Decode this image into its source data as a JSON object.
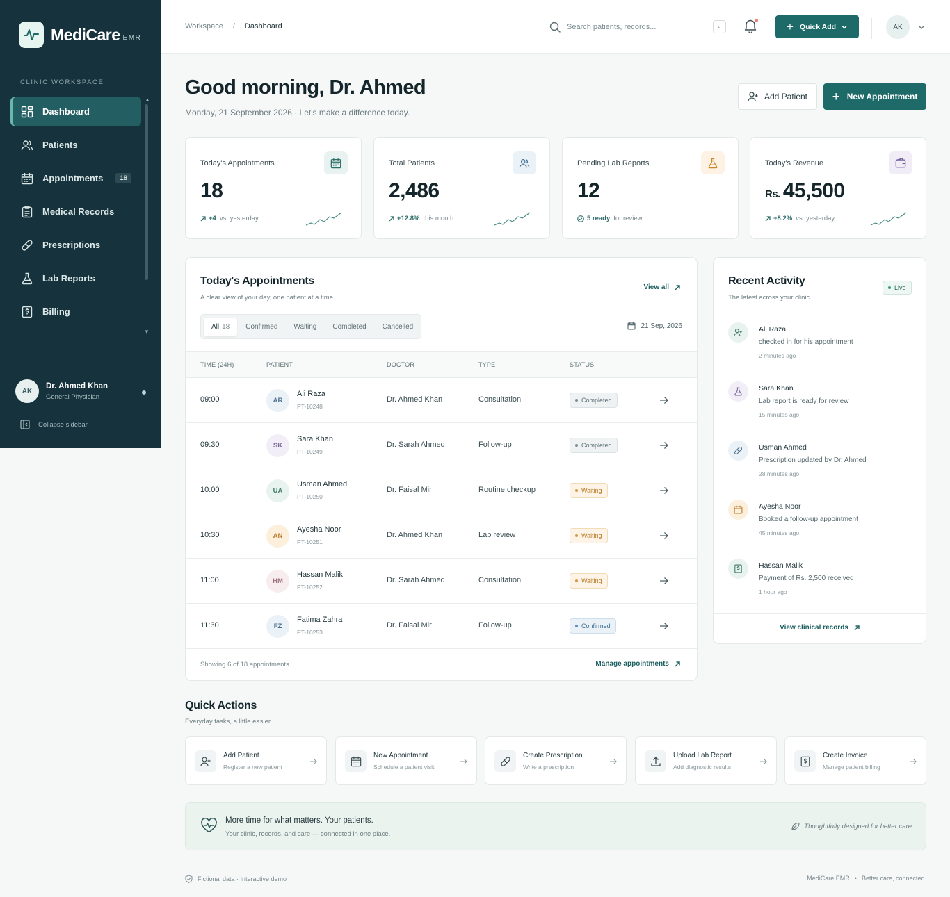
{
  "brand": {
    "name": "MediCare",
    "suffix": "EMR"
  },
  "sidebar": {
    "section_label": "CLINIC WORKSPACE",
    "items": [
      {
        "label": "Dashboard",
        "icon": "grid-icon"
      },
      {
        "label": "Patients",
        "icon": "users-icon"
      },
      {
        "label": "Appointments",
        "icon": "calendar-icon",
        "badge": "18"
      },
      {
        "label": "Medical Records",
        "icon": "clipboard-icon"
      },
      {
        "label": "Prescriptions",
        "icon": "pill-icon"
      },
      {
        "label": "Lab Reports",
        "icon": "flask-icon"
      },
      {
        "label": "Billing",
        "icon": "invoice-icon"
      }
    ],
    "user": {
      "initials": "AK",
      "name": "Dr. Ahmed Khan",
      "role": "General Physician"
    },
    "collapse_label": "Collapse sidebar"
  },
  "topbar": {
    "breadcrumb": [
      "Workspace",
      "Dashboard"
    ],
    "search_placeholder": "Search patients, records...",
    "search_shortcut": "⌕",
    "quick_add_label": "Quick Add",
    "avatar_initials": "AK"
  },
  "header": {
    "greeting": "Good morning, Dr. Ahmed",
    "subtitle": "Monday, 21 September 2026 · Let's make a difference today.",
    "add_patient_label": "Add Patient",
    "new_appointment_label": "New Appointment"
  },
  "stats": [
    {
      "label": "Today's Appointments",
      "value": "18",
      "delta": "+4",
      "delta_note": "vs. yesterday",
      "icon": "calendar-icon"
    },
    {
      "label": "Total Patients",
      "value": "2,486",
      "delta": "+12.8%",
      "delta_note": "this month",
      "icon": "users-icon"
    },
    {
      "label": "Pending Lab Reports",
      "value": "12",
      "delta": "5 ready",
      "delta_note": "for review",
      "icon": "flask-icon"
    },
    {
      "label": "Today's Revenue",
      "currency": "Rs.",
      "value": "45,500",
      "delta": "+8.2%",
      "delta_note": "vs. yesterday",
      "icon": "wallet-icon"
    }
  ],
  "appointments": {
    "title": "Today's Appointments",
    "subtitle": "A clear view of your day, one patient at a time.",
    "view_all": "View all",
    "tabs": [
      {
        "label": "All",
        "count": "18"
      },
      {
        "label": "Confirmed"
      },
      {
        "label": "Waiting"
      },
      {
        "label": "Completed"
      },
      {
        "label": "Cancelled"
      }
    ],
    "date": "21 Sep, 2026",
    "columns": [
      "TIME (24H)",
      "PATIENT",
      "DOCTOR",
      "TYPE",
      "STATUS"
    ],
    "rows": [
      {
        "time": "09:00",
        "initials": "AR",
        "name": "Ali Raza",
        "id": "PT-10248",
        "doctor": "Dr. Ahmed Khan",
        "type": "Consultation",
        "status": "Completed"
      },
      {
        "time": "09:30",
        "initials": "SK",
        "name": "Sara Khan",
        "id": "PT-10249",
        "doctor": "Dr. Sarah Ahmed",
        "type": "Follow-up",
        "status": "Completed"
      },
      {
        "time": "10:00",
        "initials": "UA",
        "name": "Usman Ahmed",
        "id": "PT-10250",
        "doctor": "Dr. Faisal Mir",
        "type": "Routine checkup",
        "status": "Waiting"
      },
      {
        "time": "10:30",
        "initials": "AN",
        "name": "Ayesha Noor",
        "id": "PT-10251",
        "doctor": "Dr. Ahmed Khan",
        "type": "Lab review",
        "status": "Waiting"
      },
      {
        "time": "11:00",
        "initials": "HM",
        "name": "Hassan Malik",
        "id": "PT-10252",
        "doctor": "Dr. Sarah Ahmed",
        "type": "Consultation",
        "status": "Waiting"
      },
      {
        "time": "11:30",
        "initials": "FZ",
        "name": "Fatima Zahra",
        "id": "PT-10253",
        "doctor": "Dr. Faisal Mir",
        "type": "Follow-up",
        "status": "Confirmed"
      }
    ],
    "footer": "Showing 6 of 18 appointments",
    "manage": "Manage appointments"
  },
  "activity": {
    "title": "Recent Activity",
    "subtitle": "The latest across your clinic",
    "live": "Live",
    "items": [
      {
        "name": "Ali Raza",
        "desc": "checked in for his appointment",
        "time": "2 minutes ago",
        "icon": "user-plus-icon"
      },
      {
        "name": "Sara Khan",
        "desc": "Lab report is ready for review",
        "time": "15 minutes ago",
        "icon": "flask-icon"
      },
      {
        "name": "Usman Ahmed",
        "desc": "Prescription updated by Dr. Ahmed",
        "time": "28 minutes ago",
        "icon": "pill-icon"
      },
      {
        "name": "Ayesha Noor",
        "desc": "Booked a follow-up appointment",
        "time": "45 minutes ago",
        "icon": "calendar-icon"
      },
      {
        "name": "Hassan Malik",
        "desc": "Payment of Rs. 2,500 received",
        "time": "1 hour ago",
        "icon": "invoice-icon"
      }
    ],
    "view_link": "View clinical records"
  },
  "quick_actions": {
    "title": "Quick Actions",
    "subtitle": "Everyday tasks, a little easier.",
    "items": [
      {
        "title": "Add Patient",
        "sub": "Register a new patient",
        "icon": "user-plus-icon"
      },
      {
        "title": "New Appointment",
        "sub": "Schedule a patient visit",
        "icon": "calendar-icon"
      },
      {
        "title": "Create Prescription",
        "sub": "Write a prescription",
        "icon": "pill-icon"
      },
      {
        "title": "Upload Lab Report",
        "sub": "Add diagnostic results",
        "icon": "upload-icon"
      },
      {
        "title": "Create Invoice",
        "sub": "Manage patient billing",
        "icon": "invoice-icon"
      }
    ]
  },
  "banner": {
    "title": "More time for what matters. Your patients.",
    "subtitle": "Your clinic, records, and care — connected in one place.",
    "right": "Thoughtfully designed for better care"
  },
  "footer": {
    "left": "Fictional data · Interactive demo",
    "right_brand": "MediCare EMR",
    "right_tag": "Better care, connected."
  },
  "colors": {
    "primary": "#1e6a68",
    "sidebar": "#16323c",
    "waiting": "#d99a3e",
    "confirmed": "#5c8fb8"
  }
}
